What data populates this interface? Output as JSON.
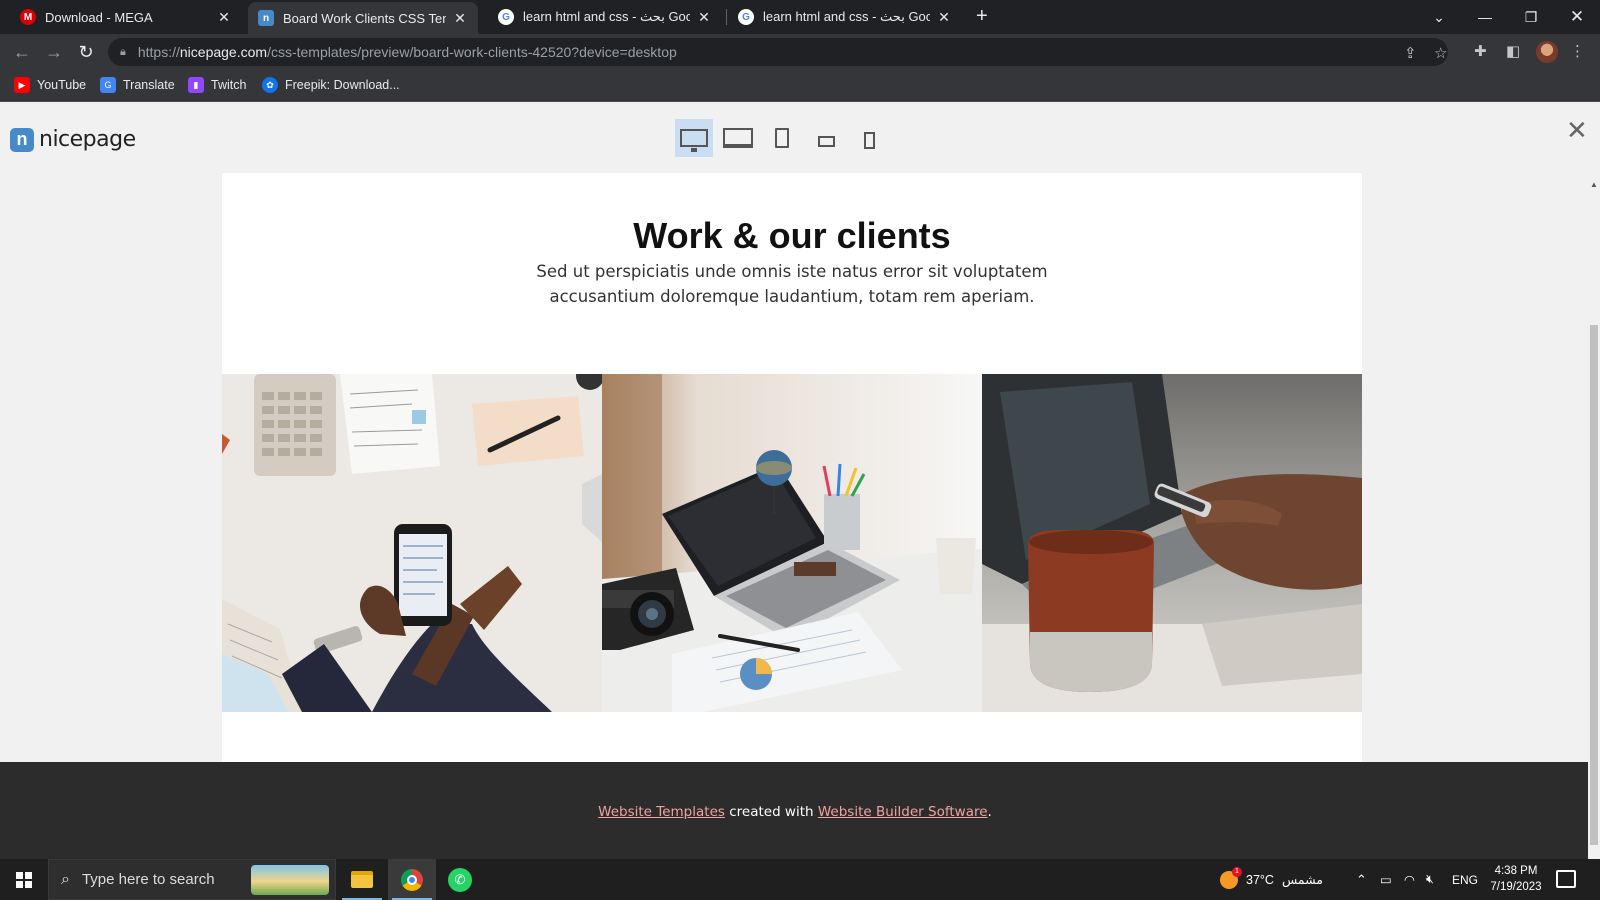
{
  "browser": {
    "tabs": [
      {
        "title": "Download - MEGA",
        "icon": "mega-icon",
        "color": "#d90007",
        "active": false
      },
      {
        "title": "Board Work Clients CSS Template",
        "icon": "nicepage-icon",
        "color": "#478ac9",
        "active": true
      },
      {
        "title": "learn html and css - بحث Google",
        "icon": "google-icon",
        "color": "#ffffff",
        "active": false
      },
      {
        "title": "learn html and css - بحث Google",
        "icon": "google-icon",
        "color": "#ffffff",
        "active": false
      }
    ],
    "url_prefix": "https://",
    "url_host": "nicepage.com",
    "url_path": "/css-templates/preview/board-work-clients-42520?device=desktop",
    "bookmarks": [
      {
        "label": "YouTube",
        "icon": "youtube-icon",
        "color": "#ff0000"
      },
      {
        "label": "Translate",
        "icon": "translate-icon",
        "color": "#4285f4"
      },
      {
        "label": "Twitch",
        "icon": "twitch-icon",
        "color": "#9146ff"
      },
      {
        "label": "Freepik: Download...",
        "icon": "freepik-icon",
        "color": "#1273eb"
      }
    ]
  },
  "preview": {
    "brand": "nicepage",
    "brand_color": "#478ac9",
    "devices": [
      "desktop",
      "laptop",
      "tablet",
      "phone-landscape",
      "phone"
    ],
    "active_device": "desktop"
  },
  "template": {
    "heading": "Work & our clients",
    "lead": "Sed ut perspiciatis unde omnis iste natus error sit voluptatem accusantium doloremque laudantium, totam rem aperiam.",
    "photos": [
      "office desk with calculator and phone",
      "laptop with camera and charts",
      "hand holding phone near coffee mug"
    ],
    "footer": {
      "link1": "Website Templates",
      "middle": " created with ",
      "link2": "Website Builder Software",
      "end": "."
    }
  },
  "taskbar": {
    "search_placeholder": "Type here to search",
    "weather_temp": "37°C",
    "weather_text": "مشمس",
    "weather_badge": "1",
    "language": "ENG",
    "time": "4:38 PM",
    "date": "7/19/2023"
  }
}
